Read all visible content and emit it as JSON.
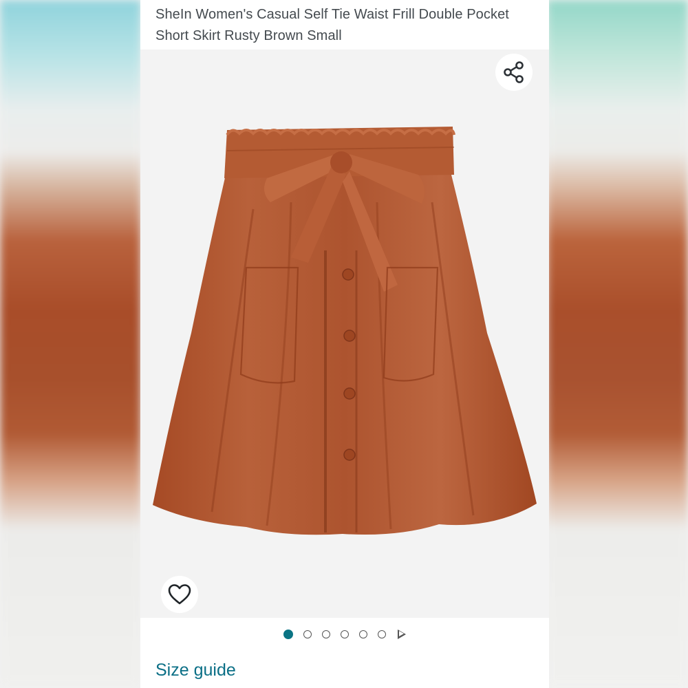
{
  "product": {
    "title": "SheIn Women's Casual Self Tie Waist Frill Double Pocket Short Skirt Rusty Brown Small"
  },
  "actions": {
    "share_icon": "share-icon",
    "wishlist_icon": "heart-icon"
  },
  "gallery": {
    "image_count": 6,
    "active_index": 0,
    "has_video": true
  },
  "links": {
    "size_guide": "Size guide"
  },
  "colors": {
    "accent": "#0a7484",
    "link": "#0b6f86",
    "product": "#b05a34"
  }
}
